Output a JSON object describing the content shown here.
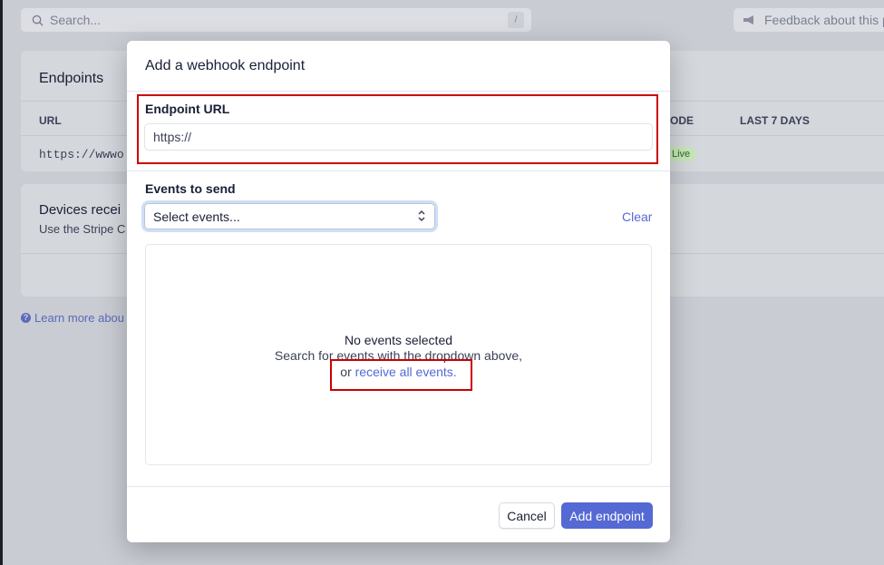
{
  "background": {
    "search_placeholder": "Search...",
    "search_shortcut": "/",
    "feedback_label": "Feedback about this p",
    "endpoints_title": "Endpoints",
    "col_url": "URL",
    "col_mode": "ODE",
    "col_last7": "LAST 7 DAYS",
    "row_url": "https://wwwo",
    "row_mode_badge": "Live",
    "devices_title": "Devices recei",
    "devices_sub": "Use the Stripe C",
    "learn_more": "Learn more abou"
  },
  "modal": {
    "title": "Add a webhook endpoint",
    "endpoint_url_label": "Endpoint URL",
    "endpoint_url_value": "https://",
    "events_label": "Events to send",
    "select_value": "Select events...",
    "clear_label": "Clear",
    "empty_title": "No events selected",
    "empty_sub": "Search for events with the dropdown above,",
    "empty_or": "or ",
    "empty_link": "receive all events.",
    "cancel_label": "Cancel",
    "add_label": "Add endpoint"
  },
  "colors": {
    "accent": "#5469d4",
    "highlight": "#cc0000",
    "live_badge": "#d7f7c2"
  }
}
